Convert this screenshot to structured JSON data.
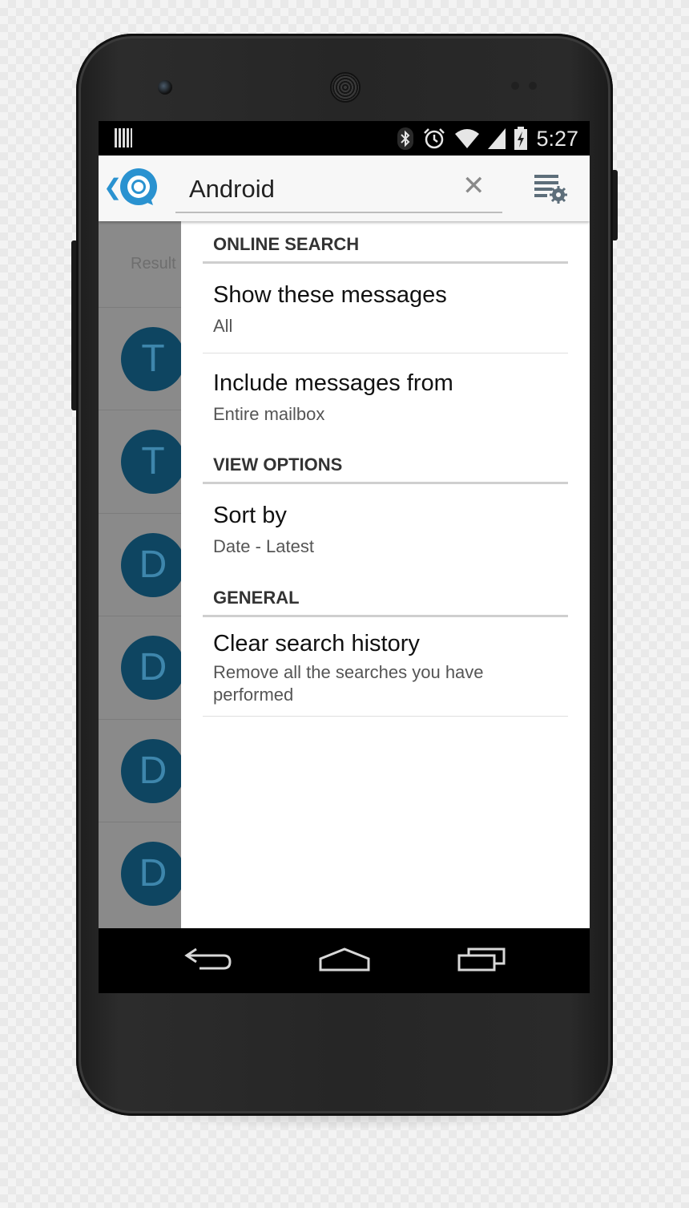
{
  "status_bar": {
    "time": "5:27",
    "icons": [
      "barcode-icon",
      "bluetooth-icon",
      "alarm-icon",
      "wifi-icon",
      "signal-icon",
      "battery-charging-icon"
    ]
  },
  "app_bar": {
    "search_value": "Android",
    "clear_icon": "close-icon",
    "settings_icon": "list-settings-icon"
  },
  "background_list": {
    "results_label": "Result",
    "avatars": [
      "T",
      "T",
      "D",
      "D",
      "D",
      "D"
    ]
  },
  "panel": {
    "sections": [
      {
        "header": "ONLINE SEARCH",
        "items": [
          {
            "title": "Show these messages",
            "subtitle": "All"
          },
          {
            "title": "Include messages from",
            "subtitle": "Entire mailbox"
          }
        ]
      },
      {
        "header": "VIEW OPTIONS",
        "items": [
          {
            "title": "Sort by",
            "subtitle": "Date - Latest"
          }
        ]
      },
      {
        "header": "GENERAL",
        "items": [
          {
            "title": "Clear search history",
            "subtitle": "Remove all the searches you have performed"
          }
        ]
      }
    ]
  },
  "nav_bar": {
    "buttons": [
      "back-icon",
      "home-icon",
      "recents-icon"
    ]
  },
  "colors": {
    "accent": "#2a92d0",
    "avatar_bg": "#0e4561",
    "avatar_text": "#3e86ac"
  }
}
